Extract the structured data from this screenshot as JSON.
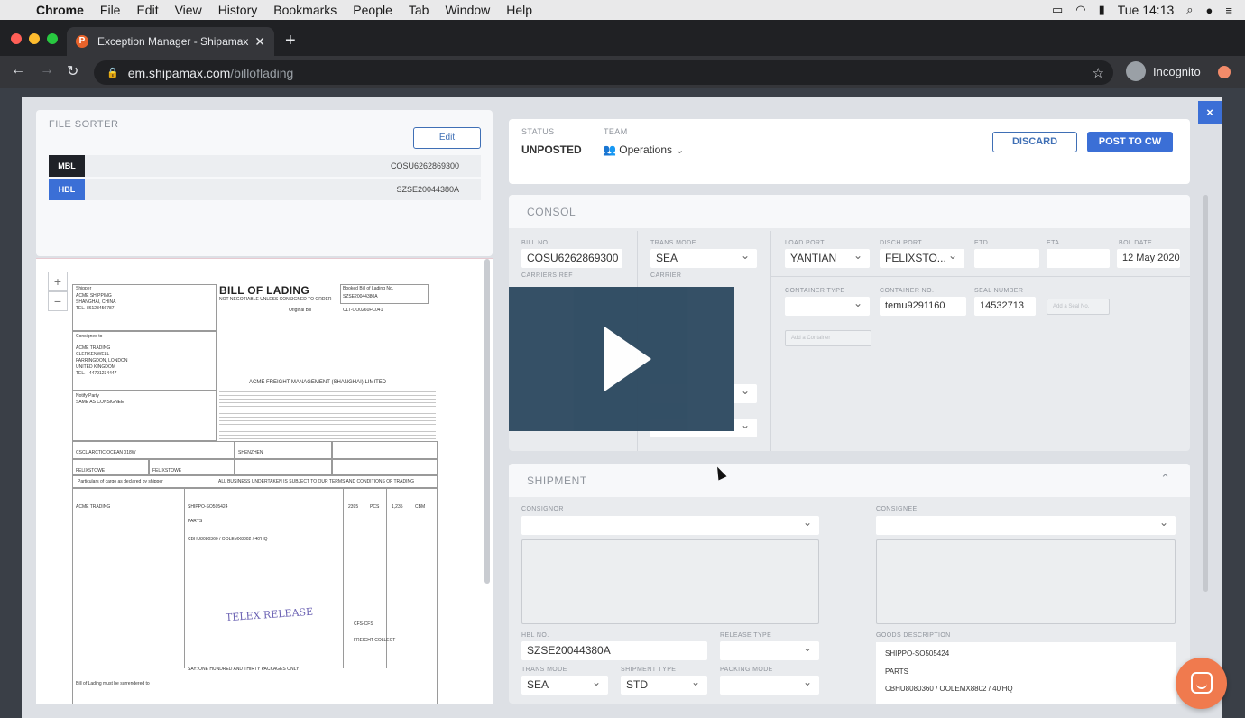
{
  "menubar": {
    "app": "Chrome",
    "items": [
      "File",
      "Edit",
      "View",
      "History",
      "Bookmarks",
      "People",
      "Tab",
      "Window",
      "Help"
    ],
    "clock": "Tue 14:13"
  },
  "browser": {
    "tab_title": "Exception Manager - Shipamax",
    "url_host": "em.shipamax.com",
    "url_path": "/billoflading",
    "profile_label": "Incognito"
  },
  "sorter": {
    "title": "FILE SORTER",
    "edit_label": "Edit",
    "documents": [
      {
        "tag": "MBL",
        "number": "COSU6262869300",
        "color": "#1f2228"
      },
      {
        "tag": "HBL",
        "number": "SZSE20044380A",
        "color": "#3b6fd6"
      }
    ]
  },
  "viewer": {
    "zoom_in": "+",
    "zoom_out": "−",
    "bol_title": "BILL OF LADING",
    "bol_subtitle": "NOT NEGOTIABLE UNLESS CONSIGNED TO ORDER",
    "bol_original": "Original Bill",
    "bol_number_label": "Booked Bill of Lading No.",
    "bol_number": "SZSE20044380A",
    "bol_ref": "CLT-OO0260FC041",
    "shipper": [
      "Shipper",
      "ACME SHIPPING",
      "SHANGHAI, CHINA",
      "TEL. 86123456787"
    ],
    "consignee": [
      "Consigned to",
      "ACME TRADING",
      "CLERKENWELL",
      "FARRINGDON, LONDON",
      "UNITED KINGDOM",
      "TEL. +44791234447"
    ],
    "notify": [
      "Notify Party",
      "SAME AS CONSIGNEE"
    ],
    "company": "ACME FREIGHT MANAGEMENT (SHANGHAI) LIMITED",
    "vessel": "CSCL ARCTIC OCEAN 018W",
    "port_loading": "SHENZHEN",
    "port_discharge": "FELIXSTOWE",
    "place_delivery": "FELIXSTOWE",
    "cargo_header": "Particulars of cargo as declared by shipper",
    "cargo_notice": "ALL BUSINESS UNDERTAKEN IS SUBJECT TO OUR TERMS AND CONDITIONS OF TRADING",
    "marks": "ACME TRADING",
    "goods": [
      "SHIPPO-SO505424",
      "PARTS",
      "CBHU8080360 / OOLEMX8802 / 40'HQ"
    ],
    "packages": "2395",
    "units": "PCS",
    "weight": "1,235",
    "measure": "CBM",
    "stamp": "TELEX RELEASE",
    "freight": "FREIGHT COLLECT",
    "cfs": "CFS-CFS",
    "total": "SAY: ONE HUNDRED AND THIRTY PACKAGES ONLY",
    "footer": "Bill of Lading must be surrendered to"
  },
  "status": {
    "status_label": "STATUS",
    "status_value": "UNPOSTED",
    "team_label": "TEAM",
    "team_value": "Operations",
    "discard_label": "DISCARD",
    "post_label": "POST TO CW",
    "close_label": "×"
  },
  "consol": {
    "title": "CONSOL",
    "bill_no_label": "BILL NO.",
    "bill_no": "COSU6262869300",
    "carriers_ref_label": "CARRIERS REF",
    "trans_mode_label": "TRANS MODE",
    "trans_mode": "SEA",
    "carrier_label": "CARRIER",
    "load_port_label": "LOAD PORT",
    "load_port": "YANTIAN",
    "disch_port_label": "DISCH PORT",
    "disch_port": "FELIXSTO...",
    "etd_label": "ETD",
    "eta_label": "ETA",
    "bol_date_label": "BOL DATE",
    "bol_date": "12 May 2020",
    "container_type_label": "CONTAINER TYPE",
    "container_no_label": "CONTAINER NO.",
    "container_no": "temu9291160",
    "seal_number_label": "SEAL NUMBER",
    "seal_number": "14532713",
    "add_seal": "Add a Seal No.",
    "add_container": "Add a Container"
  },
  "shipment": {
    "title": "SHIPMENT",
    "consignor_label": "CONSIGNOR",
    "consignee_label": "CONSIGNEE",
    "hbl_no_label": "HBL NO.",
    "hbl_no": "SZSE20044380A",
    "release_type_label": "RELEASE TYPE",
    "goods_desc_label": "GOODS DESCRIPTION",
    "goods_lines": [
      "SHIPPO-SO505424",
      "PARTS",
      "CBHU8080360 / OOLEMX8802 / 40'HQ"
    ],
    "trans_mode_label": "TRANS MODE",
    "trans_mode": "SEA",
    "shipment_type_label": "SHIPMENT TYPE",
    "shipment_type": "STD",
    "packing_mode_label": "PACKING MODE"
  }
}
